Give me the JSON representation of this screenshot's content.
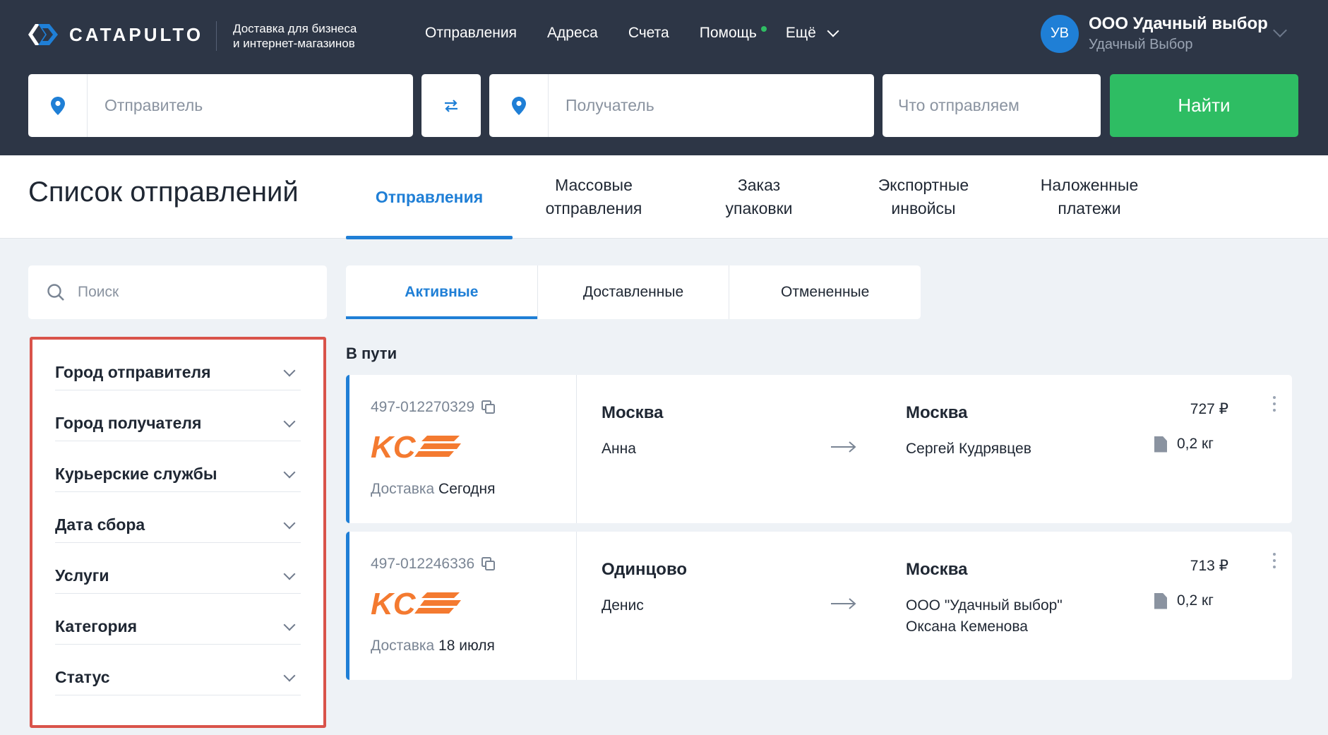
{
  "header": {
    "brand": "CATAPULTO",
    "tagline_line1": "Доставка для бизнеса",
    "tagline_line2": "и интернет-магазинов",
    "nav": [
      "Отправления",
      "Адреса",
      "Счета",
      "Помощь"
    ],
    "more_label": "Ещё",
    "user_initials": "УВ",
    "user_name": "ООО Удачный выбор",
    "user_sub": "Удачный Выбор",
    "sender_placeholder": "Отправитель",
    "receiver_placeholder": "Получатель",
    "what_placeholder": "Что отправляем",
    "find_label": "Найти"
  },
  "page": {
    "title": "Список отправлений",
    "tabs": [
      {
        "line1": "Отправления",
        "line2": ""
      },
      {
        "line1": "Массовые",
        "line2": "отправления"
      },
      {
        "line1": "Заказ",
        "line2": "упаковки"
      },
      {
        "line1": "Экспортные",
        "line2": "инвойсы"
      },
      {
        "line1": "Наложенные",
        "line2": "платежи"
      }
    ]
  },
  "sidebar": {
    "search_placeholder": "Поиск",
    "filters": [
      "Город отправителя",
      "Город получателя",
      "Курьерские службы",
      "Дата сбора",
      "Услуги",
      "Категория",
      "Статус"
    ]
  },
  "status_tabs": [
    "Активные",
    "Доставленные",
    "Отмененные"
  ],
  "section_title": "В пути",
  "shipments": [
    {
      "track": "497-012270329",
      "carrier": "KCE",
      "eta_label": "Доставка",
      "eta_value": "Сегодня",
      "from_city": "Москва",
      "from_person": "Анна",
      "to_city": "Москва",
      "to_person_line1": "Сергей Кудрявцев",
      "to_person_line2": "",
      "price": "727 ₽",
      "weight": "0,2 кг"
    },
    {
      "track": "497-012246336",
      "carrier": "KCE",
      "eta_label": "Доставка",
      "eta_value": "18 июля",
      "from_city": "Одинцово",
      "from_person": "Денис",
      "to_city": "Москва",
      "to_person_line1": "ООО \"Удачный выбор\"",
      "to_person_line2": "Оксана Кеменова",
      "price": "713 ₽",
      "weight": "0,2 кг"
    }
  ],
  "colors": {
    "accent": "#1f7fd6",
    "success": "#2ebd63",
    "header_bg": "#2d3646",
    "carrier_orange": "#f47a30",
    "highlight": "#d9534a"
  }
}
